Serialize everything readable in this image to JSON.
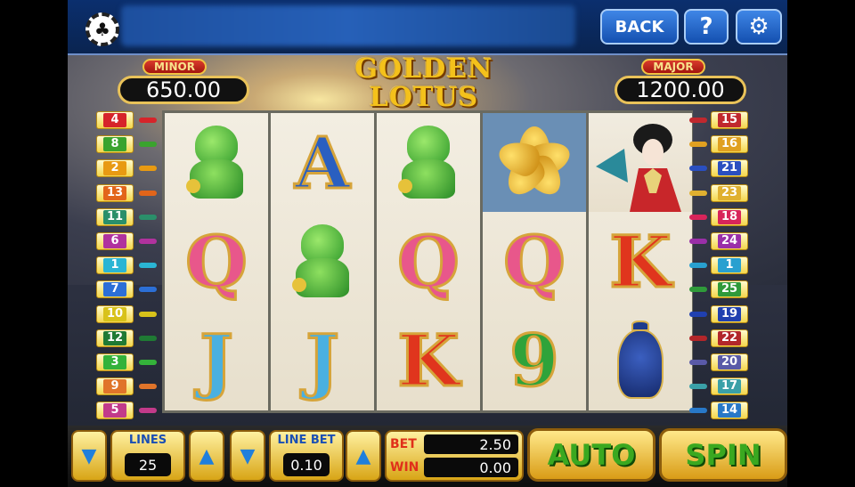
{
  "topbar": {
    "back_label": "BACK",
    "help_label": "?",
    "settings_icon": "gear-icon",
    "chip_icon": "club-chip-icon"
  },
  "jackpots": {
    "minor_label": "MINOR",
    "minor_value": "650.00",
    "major_label": "MAJOR",
    "major_value": "1200.00"
  },
  "logo": {
    "line1": "GOLDEN",
    "line2": "LOTUS"
  },
  "reels": [
    [
      "lion",
      "Q",
      "J"
    ],
    [
      "A",
      "lion",
      "J"
    ],
    [
      "lion",
      "Q",
      "K"
    ],
    [
      "lotus",
      "Q",
      "9"
    ],
    [
      "geisha",
      "K",
      "vase"
    ]
  ],
  "paylines_left": [
    "4",
    "8",
    "2",
    "13",
    "11",
    "6",
    "1",
    "7",
    "10",
    "12",
    "3",
    "9",
    "5"
  ],
  "paylines_right": [
    "15",
    "16",
    "21",
    "23",
    "18",
    "24",
    "1",
    "25",
    "19",
    "22",
    "20",
    "17",
    "14"
  ],
  "controls": {
    "lines_label": "LINES",
    "lines_value": "25",
    "linebet_label": "LINE BET",
    "linebet_value": "0.10",
    "bet_label": "BET",
    "bet_value": "2.50",
    "win_label": "WIN",
    "win_value": "0.00",
    "auto_label": "AUTO",
    "spin_label": "SPIN"
  },
  "colors": {
    "gold": "#f4c11b",
    "spin_green": "#3aa820",
    "topbar_blue": "#0b2f6e"
  }
}
